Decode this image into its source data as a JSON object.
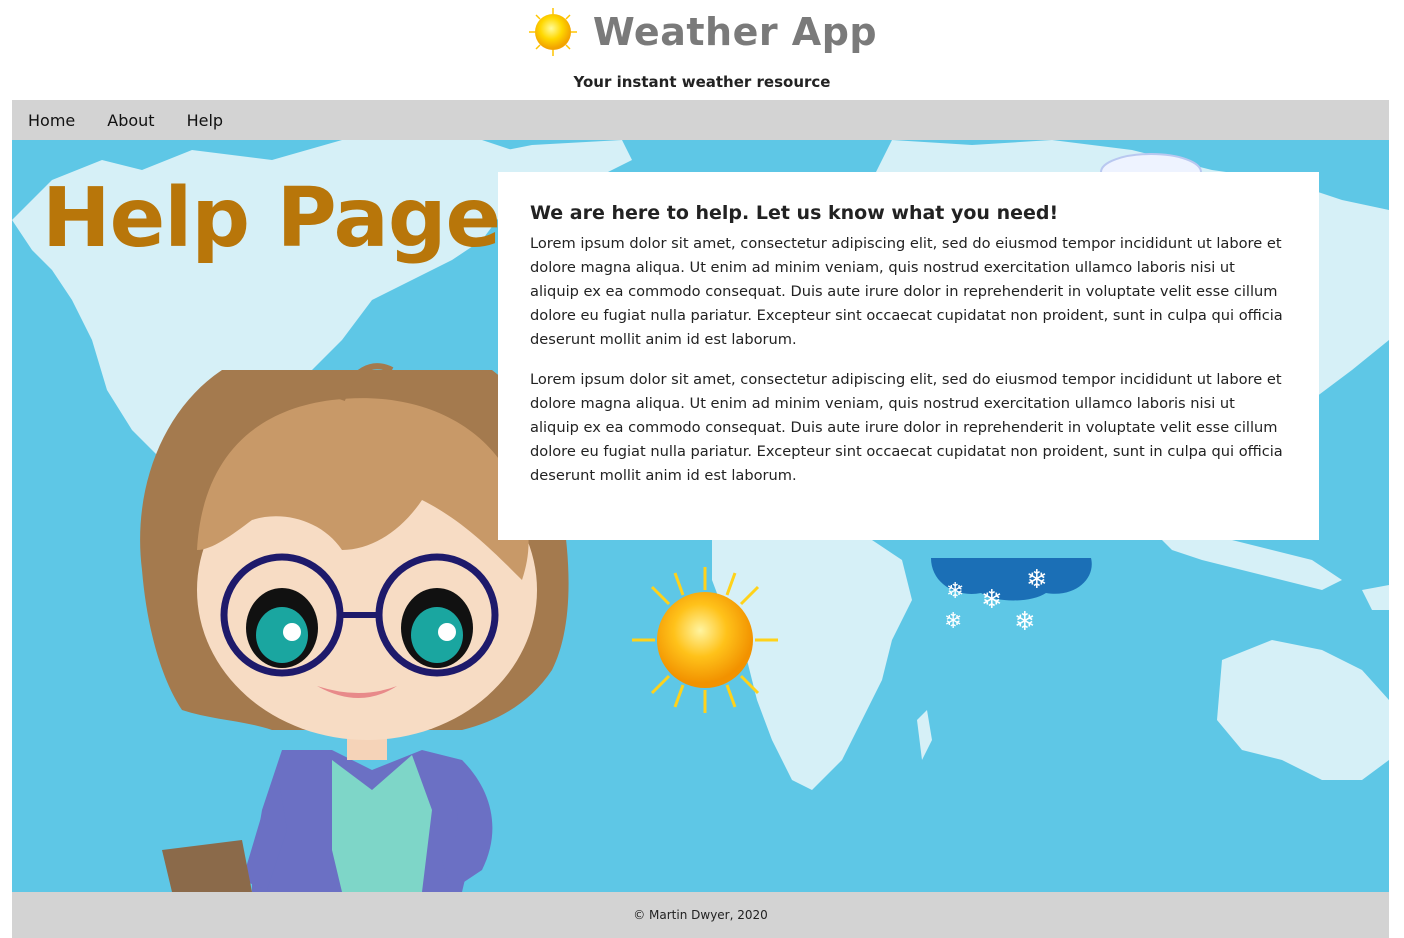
{
  "header": {
    "logo_icon": "sun-icon",
    "title": "Weather App",
    "tagline": "Your instant weather resource"
  },
  "nav": {
    "items": [
      {
        "label": "Home"
      },
      {
        "label": "About"
      },
      {
        "label": "Help"
      }
    ]
  },
  "hero": {
    "title": "Help Page",
    "illustrations": [
      "world-map",
      "cartoon-girl-with-glasses",
      "sun-icon",
      "snow-cloud-icon",
      "cloud-icon"
    ]
  },
  "card": {
    "heading": "We are here to help. Let us know what you need!",
    "paragraphs": [
      "Lorem ipsum dolor sit amet, consectetur adipiscing elit, sed do eiusmod tempor incididunt ut labore et dolore magna aliqua. Ut enim ad minim veniam, quis nostrud exercitation ullamco laboris nisi ut aliquip ex ea commodo consequat. Duis aute irure dolor in reprehenderit in voluptate velit esse cillum dolore eu fugiat nulla pariatur. Excepteur sint occaecat cupidatat non proident, sunt in culpa qui officia deserunt mollit anim id est laborum.",
      "Lorem ipsum dolor sit amet, consectetur adipiscing elit, sed do eiusmod tempor incididunt ut labore et dolore magna aliqua. Ut enim ad minim veniam, quis nostrud exercitation ullamco laboris nisi ut aliquip ex ea commodo consequat. Duis aute irure dolor in reprehenderit in voluptate velit esse cillum dolore eu fugiat nulla pariatur. Excepteur sint occaecat cupidatat non proident, sunt in culpa qui officia deserunt mollit anim id est laborum."
    ]
  },
  "footer": {
    "copyright": "© Martin Dwyer, 2020"
  },
  "colors": {
    "nav_bg": "#d3d3d3",
    "hero_bg": "#5ec7e6",
    "map_land": "#d6f0f7",
    "title_accent": "#b8760a",
    "app_title": "#7a7a7a"
  }
}
